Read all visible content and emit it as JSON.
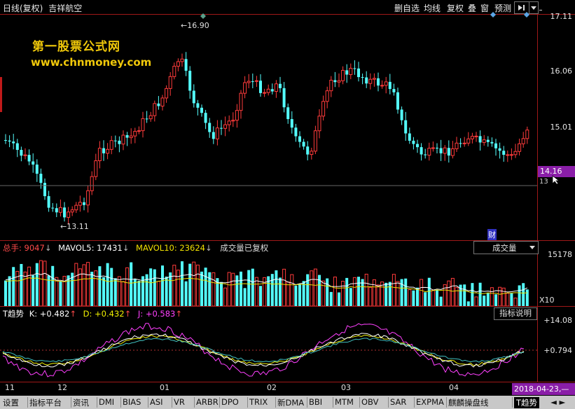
{
  "topbar": {
    "title": "日线(复权)",
    "stock_name": "吉祥航空",
    "buttons": [
      "删自选",
      "均线",
      "复权",
      "叠",
      "窗",
      "预测"
    ],
    "nav_icon": "arrow-right-bar-icon",
    "menu_icon": "caret-down-icon"
  },
  "watermark": {
    "line1": "第一股票公式网",
    "line2": "www.chnmoney.com"
  },
  "price_axis": {
    "labels": [
      "17.11",
      "16.06",
      "15.01"
    ],
    "current_price": "14.16",
    "partial_label": "13"
  },
  "price_annotations": {
    "high": "16.90",
    "low": "13.11",
    "finance_marker": "财"
  },
  "volume_panel": {
    "label_total": "总手:",
    "total_value": "9047",
    "ma5_label": "MAVOL5:",
    "ma5_value": "17431",
    "ma10_label": "MAVOL10:",
    "ma10_value": "23624",
    "note": "成交量已复权",
    "dropdown": "成交量",
    "axis_top": "15178",
    "axis_unit": "X10"
  },
  "indicator_panel": {
    "name": "T趋势",
    "k_label": "K:",
    "k_value": "+0.482",
    "d_label": "D:",
    "d_value": "+0.432",
    "j_label": "J:",
    "j_value": "+0.583",
    "help_button": "指标说明",
    "axis_top": "+14.08",
    "axis_mid": "+0.794"
  },
  "x_axis": {
    "months": [
      "11",
      "12",
      "01",
      "02",
      "03",
      "04"
    ],
    "date_readout": "2018-04-23,—"
  },
  "tabs": [
    "设置",
    "指标平台",
    "资讯",
    "DMI",
    "BIAS",
    "ASI",
    "VR",
    "ARBR",
    "DPO",
    "TRIX",
    "新DMA",
    "BBI",
    "MTM",
    "OBV",
    "SAR",
    "EXPMA",
    "麒麟操盘线",
    "T趋势"
  ],
  "colors": {
    "up": "#ff3b3b",
    "down": "#54ffff",
    "border": "#a01818",
    "ma5": "#ffffff",
    "ma10": "#f0e000",
    "k_line": "#ffffff",
    "d_line": "#f0f000",
    "j_line": "#ff40ff",
    "accent_purple": "#8a1ea8"
  }
}
